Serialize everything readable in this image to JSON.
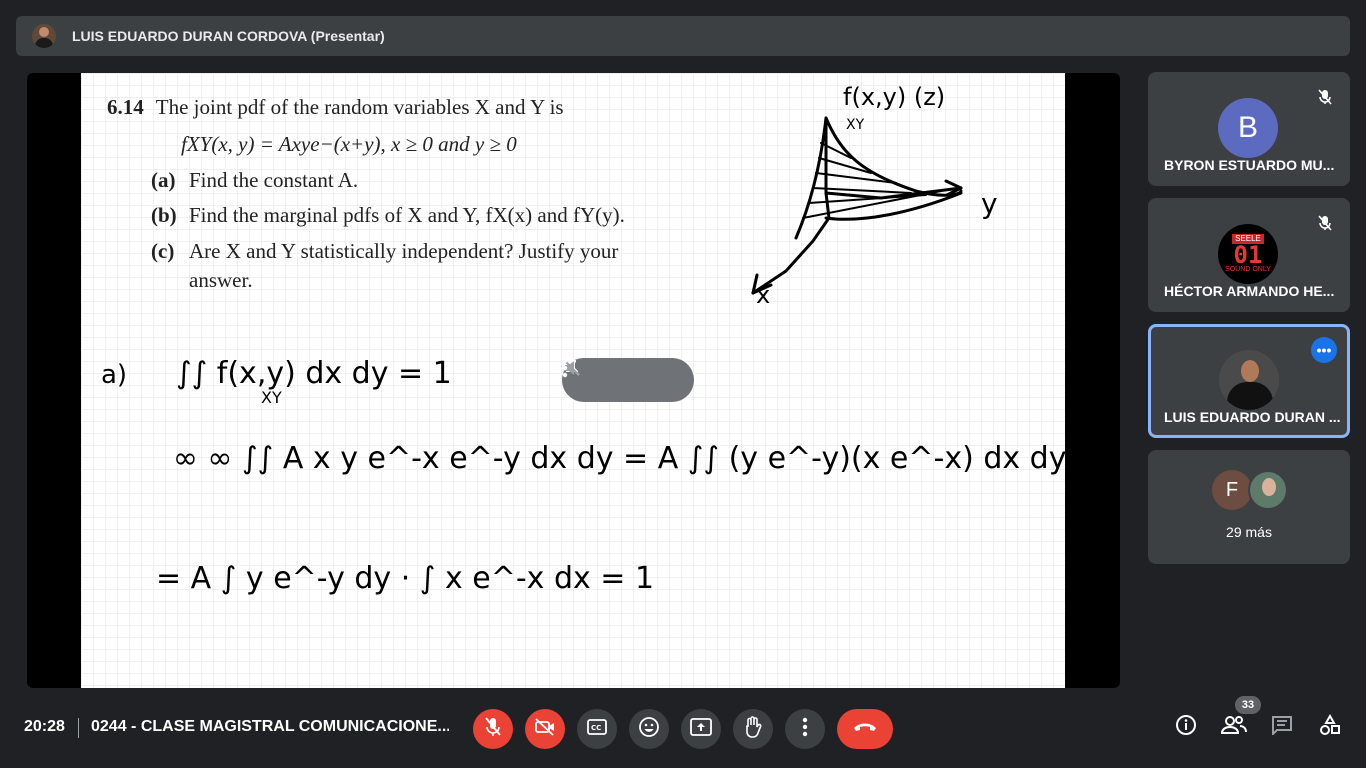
{
  "presenter": {
    "name": "LUIS EDUARDO DURAN CORDOVA (Presentar)"
  },
  "slide": {
    "problem_number": "6.14",
    "problem_text": "The joint pdf of the random variables X and Y is",
    "formula": "fXY(x, y) = Axye−(x+y),  x ≥ 0 and y ≥ 0",
    "parts": [
      {
        "label": "(a)",
        "text": "Find the constant A."
      },
      {
        "label": "(b)",
        "text": "Find the marginal pdfs of X and Y, fX(x) and fY(y)."
      },
      {
        "label": "(c)",
        "text": "Are X and Y statistically independent? Justify your answer."
      }
    ],
    "handwriting": {
      "a_label": "a)",
      "line1": "∫∫ f(x,y) dx dy = 1",
      "line1_sub": "XY",
      "line2": "∞ ∞ ∫∫ A x y e^-x e^-y dx dy = A ∫∫ (y e^-y)(x e^-x) dx dy",
      "line3": "= A ∫ y e^-y dy · ∫ x e^-x dx = 1",
      "sketch_label": "f(x,y) (z)",
      "sketch_sub": "XY",
      "axis_x": "x",
      "axis_y": "y"
    }
  },
  "participants": [
    {
      "name": "BYRON ESTUARDO MU...",
      "initial": "B",
      "avatar_color": "#5c6bc0",
      "muted": true
    },
    {
      "name": "HÉCTOR ARMANDO HE...",
      "avatar_text": [
        "SEELE",
        "01",
        "SOUND ONLY"
      ],
      "muted": true
    },
    {
      "name": "LUIS EDUARDO DURAN ...",
      "active": true,
      "more": "•••"
    },
    {
      "initial": "F",
      "more_label": "29 más"
    }
  ],
  "bottom": {
    "time": "20:28",
    "meeting_title": "0244 - CLASE MAGISTRAL COMUNICACIONE...",
    "participant_count": "33"
  },
  "colors": {
    "accent": "#8ab4f8",
    "danger": "#ea4335",
    "surface": "#3c4043",
    "background": "#202124"
  }
}
